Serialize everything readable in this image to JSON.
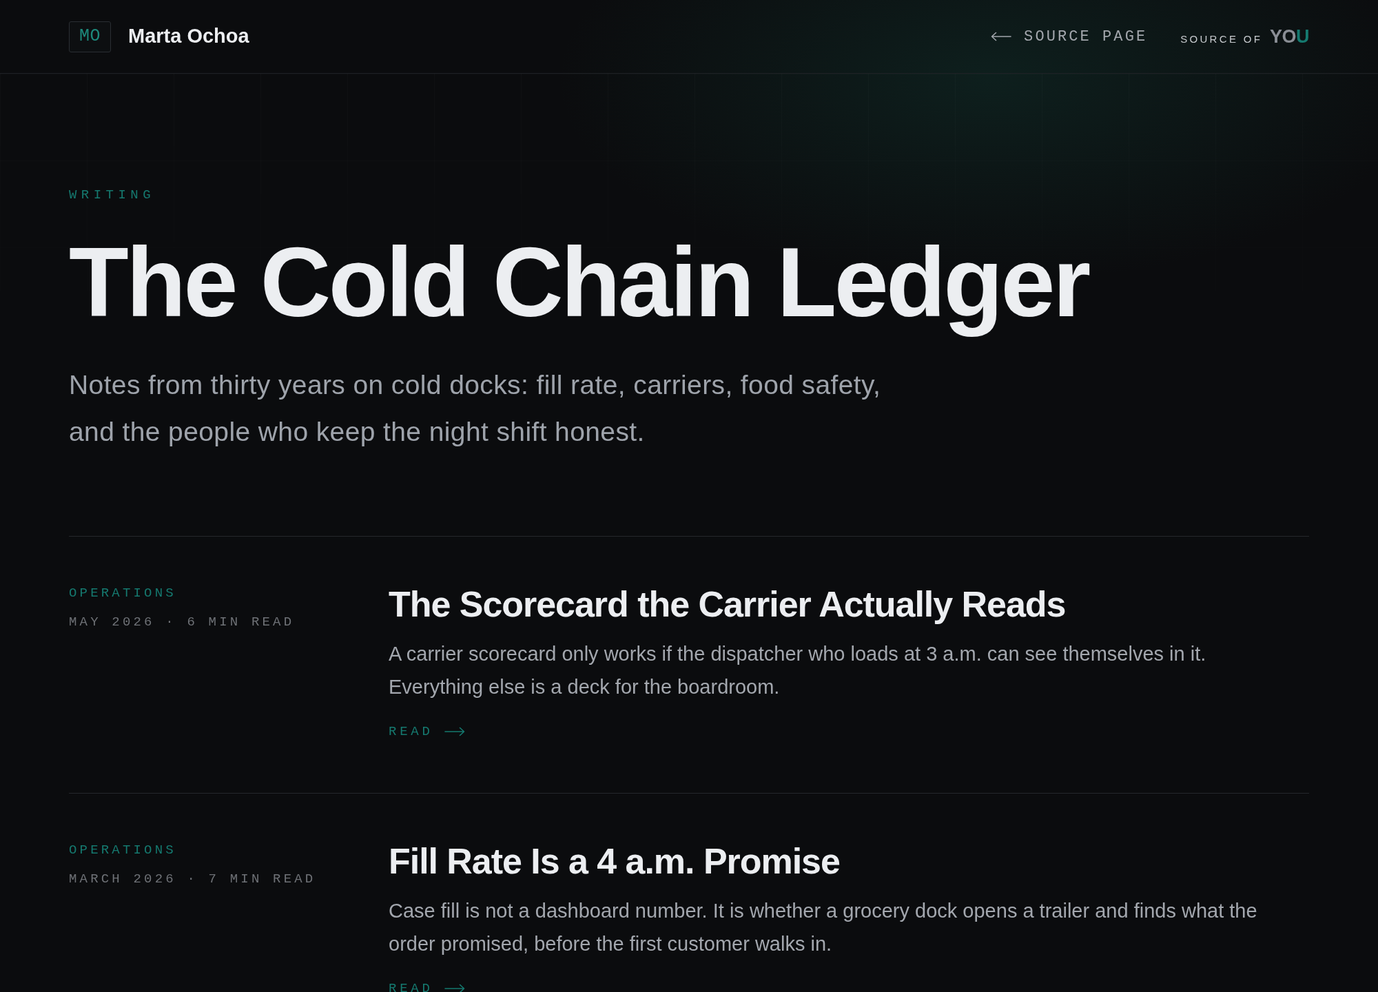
{
  "header": {
    "monogram": "MO",
    "name": "Marta Ochoa",
    "nav_link": {
      "label": "SOURCE PAGE"
    },
    "brand": {
      "label": "SOURCE OF",
      "wordmark": "YOU"
    }
  },
  "hero": {
    "eyebrow": "WRITING",
    "title": "The Cold Chain Ledger",
    "subtitle": "Notes from thirty years on cold docks: fill rate, carriers, food safety, and the people who keep the night shift honest."
  },
  "articles": [
    {
      "category": "OPERATIONS",
      "meta": "MAY 2026 · 6 MIN READ",
      "title": "The Scorecard the Carrier Actually Reads",
      "excerpt": "A carrier scorecard only works if the dispatcher who loads at 3 a.m. can see themselves in it. Everything else is a deck for the boardroom.",
      "link": "READ"
    },
    {
      "category": "OPERATIONS",
      "meta": "MARCH 2026 · 7 MIN READ",
      "title": "Fill Rate Is a 4 a.m. Promise",
      "excerpt": "Case fill is not a dashboard number. It is whether a grocery dock opens a trailer and finds what the order promised, before the first customer walks in.",
      "link": "READ"
    }
  ]
}
